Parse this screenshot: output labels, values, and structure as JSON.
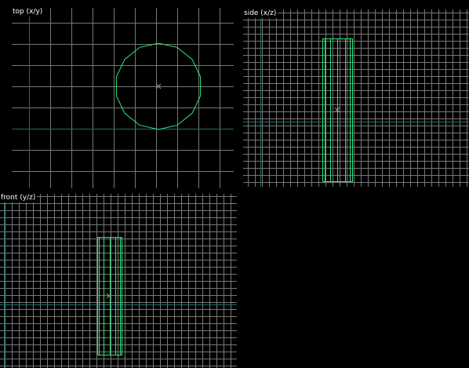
{
  "colors": {
    "background": "#000000",
    "grid": "#777777",
    "axis": "#1f6b6b",
    "wireframe": "#2ee87a",
    "center_marker": "#9a9a9a",
    "label_text": "#ffffff"
  },
  "viewports": {
    "top": {
      "label": "top (x/y)"
    },
    "side": {
      "label": "side (x/z)"
    },
    "front": {
      "label": "front (y/z)"
    }
  }
}
